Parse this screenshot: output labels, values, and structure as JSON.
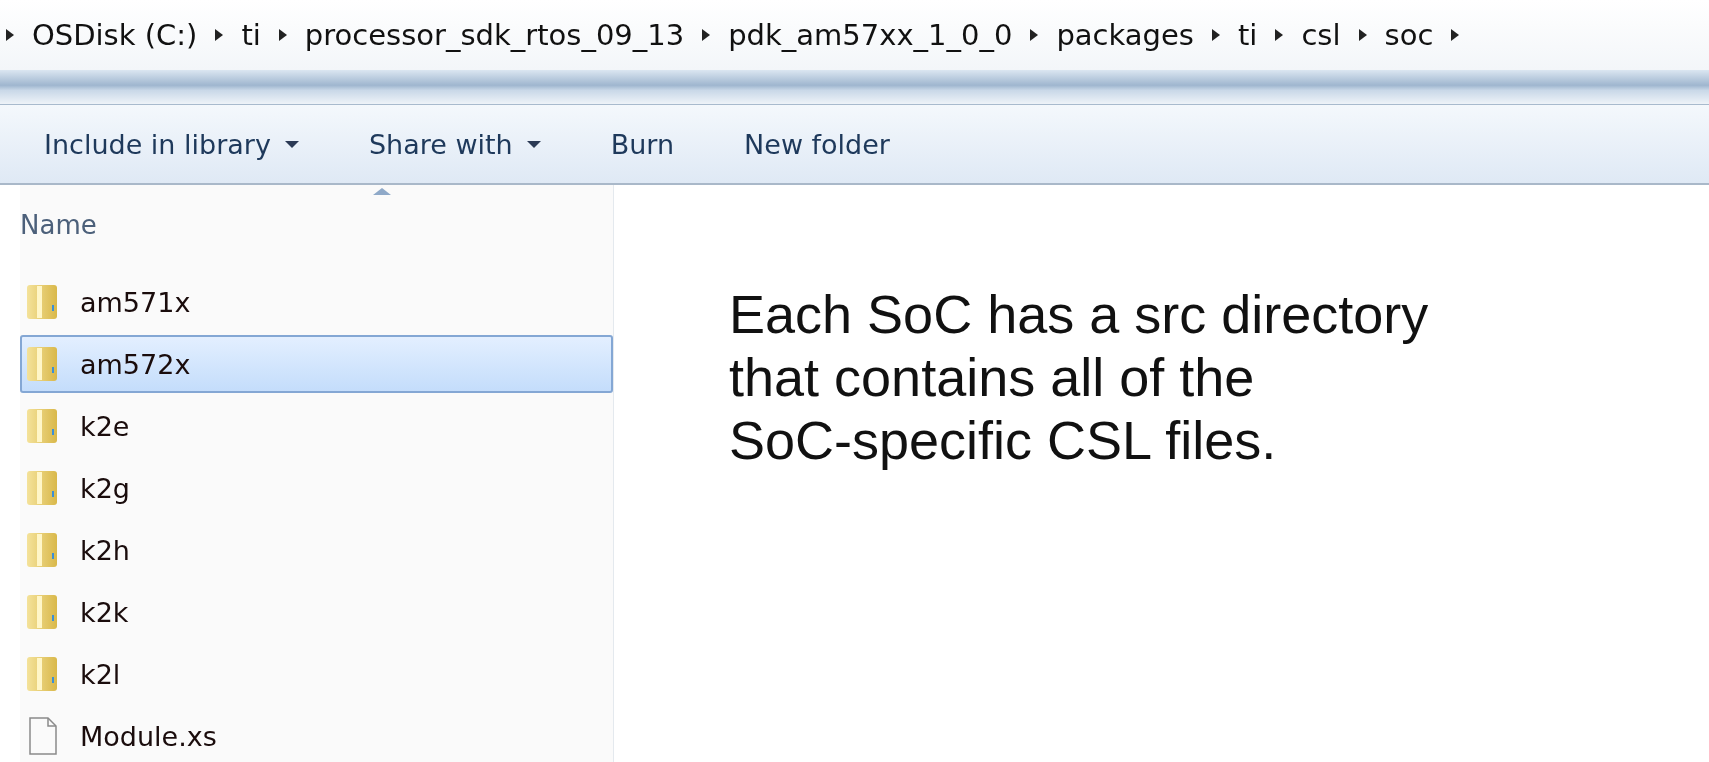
{
  "breadcrumb": [
    "OSDisk (C:)",
    "ti",
    "processor_sdk_rtos_09_13",
    "pdk_am57xx_1_0_0",
    "packages",
    "ti",
    "csl",
    "soc"
  ],
  "toolbar": [
    {
      "label": "Include in library",
      "dropdown": true
    },
    {
      "label": "Share with",
      "dropdown": true
    },
    {
      "label": "Burn",
      "dropdown": false
    },
    {
      "label": "New folder",
      "dropdown": false
    }
  ],
  "columns": [
    {
      "label": "Name",
      "sorted": true
    }
  ],
  "files": [
    {
      "name": "am571x",
      "kind": "folder",
      "selected": false
    },
    {
      "name": "am572x",
      "kind": "folder",
      "selected": true
    },
    {
      "name": "k2e",
      "kind": "folder",
      "selected": false
    },
    {
      "name": "k2g",
      "kind": "folder",
      "selected": false
    },
    {
      "name": "k2h",
      "kind": "folder",
      "selected": false
    },
    {
      "name": "k2k",
      "kind": "folder",
      "selected": false
    },
    {
      "name": "k2l",
      "kind": "folder",
      "selected": false
    },
    {
      "name": "Module.xs",
      "kind": "file",
      "selected": false
    }
  ],
  "annotation": "Each SoC has a src directory\nthat contains all of the\nSoC-specific CSL files."
}
